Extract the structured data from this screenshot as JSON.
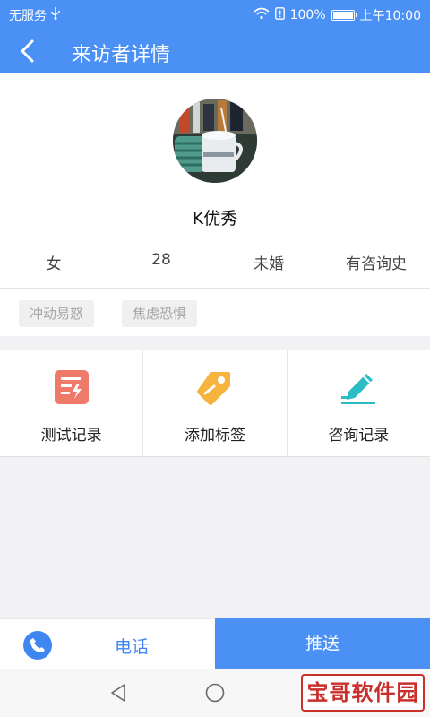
{
  "statusbar": {
    "carrier": "无服务",
    "battery": "100%",
    "time": "上午10:00",
    "battery_level": 1.0
  },
  "header": {
    "title": "来访者详情",
    "back_icon": "chevron-left-icon"
  },
  "profile": {
    "name": "K优秀",
    "gender": "女",
    "age": "28",
    "marital": "未婚",
    "history": "有咨询史"
  },
  "tags": [
    "冲动易怒",
    "焦虑恐惧"
  ],
  "actions": [
    {
      "label": "测试记录",
      "icon": "test-record-icon",
      "color": "#f07a6a"
    },
    {
      "label": "添加标签",
      "icon": "tag-icon",
      "color": "#f6b33d"
    },
    {
      "label": "咨询记录",
      "icon": "edit-pen-icon",
      "color": "#2bbcc4"
    }
  ],
  "bottom": {
    "call_label": "电话",
    "push_label": "推送"
  },
  "watermark": "宝哥软件园",
  "colors": {
    "primary": "#4a90f5",
    "call_text": "#3f86f0"
  }
}
